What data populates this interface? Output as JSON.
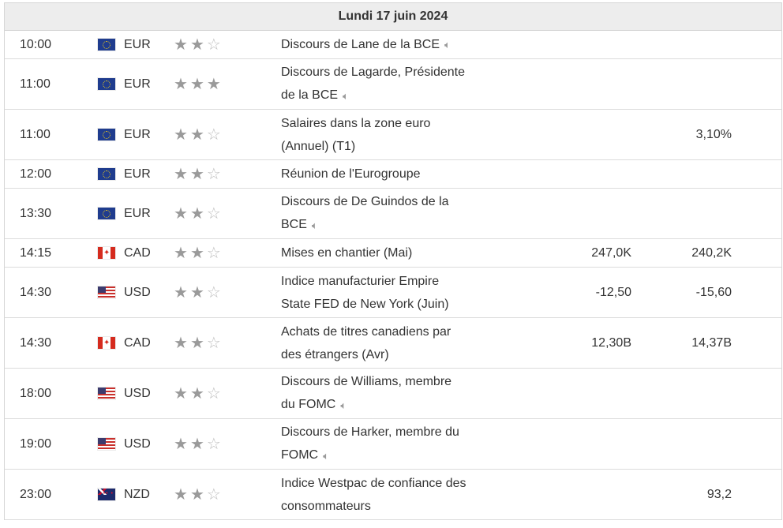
{
  "header": {
    "date": "Lundi 17 juin 2024"
  },
  "icons": {
    "speaker": "speaker-icon",
    "star_full": "star-filled-icon",
    "star_empty": "star-empty-icon"
  },
  "rows": [
    {
      "time": "10:00",
      "flag": "eu",
      "currency": "EUR",
      "stars": 2,
      "event_line1": "Discours de Lane de la BCE",
      "event_line2": "",
      "speaker": true,
      "actual": "",
      "forecast": ""
    },
    {
      "time": "11:00",
      "flag": "eu",
      "currency": "EUR",
      "stars": 3,
      "event_line1": "Discours de Lagarde, Présidente",
      "event_line2": "de la BCE",
      "speaker": true,
      "actual": "",
      "forecast": ""
    },
    {
      "time": "11:00",
      "flag": "eu",
      "currency": "EUR",
      "stars": 2,
      "event_line1": "Salaires dans la zone euro",
      "event_line2": "(Annuel) (T1)",
      "speaker": false,
      "actual": "",
      "forecast": "3,10%"
    },
    {
      "time": "12:00",
      "flag": "eu",
      "currency": "EUR",
      "stars": 2,
      "event_line1": "Réunion de l'Eurogroupe",
      "event_line2": "",
      "speaker": false,
      "actual": "",
      "forecast": ""
    },
    {
      "time": "13:30",
      "flag": "eu",
      "currency": "EUR",
      "stars": 2,
      "event_line1": "Discours de De Guindos de la",
      "event_line2": "BCE",
      "speaker": true,
      "actual": "",
      "forecast": ""
    },
    {
      "time": "14:15",
      "flag": "ca",
      "currency": "CAD",
      "stars": 2,
      "event_line1": "Mises en chantier (Mai)",
      "event_line2": "",
      "speaker": false,
      "actual": "247,0K",
      "forecast": "240,2K"
    },
    {
      "time": "14:30",
      "flag": "us",
      "currency": "USD",
      "stars": 2,
      "event_line1": "Indice manufacturier Empire",
      "event_line2": "State FED de New York (Juin)",
      "speaker": false,
      "actual": "-12,50",
      "forecast": "-15,60"
    },
    {
      "time": "14:30",
      "flag": "ca",
      "currency": "CAD",
      "stars": 2,
      "event_line1": "Achats de titres canadiens par",
      "event_line2": "des étrangers (Avr)",
      "speaker": false,
      "actual": "12,30B",
      "forecast": "14,37B"
    },
    {
      "time": "18:00",
      "flag": "us",
      "currency": "USD",
      "stars": 2,
      "event_line1": "Discours de Williams, membre",
      "event_line2": "du FOMC",
      "speaker": true,
      "actual": "",
      "forecast": ""
    },
    {
      "time": "19:00",
      "flag": "us",
      "currency": "USD",
      "stars": 2,
      "event_line1": "Discours de Harker, membre du",
      "event_line2": "FOMC",
      "speaker": true,
      "actual": "",
      "forecast": ""
    },
    {
      "time": "23:00",
      "flag": "nz",
      "currency": "NZD",
      "stars": 2,
      "event_line1": "Indice Westpac de confiance des",
      "event_line2": "consommateurs",
      "speaker": false,
      "actual": "",
      "forecast": "93,2"
    }
  ]
}
